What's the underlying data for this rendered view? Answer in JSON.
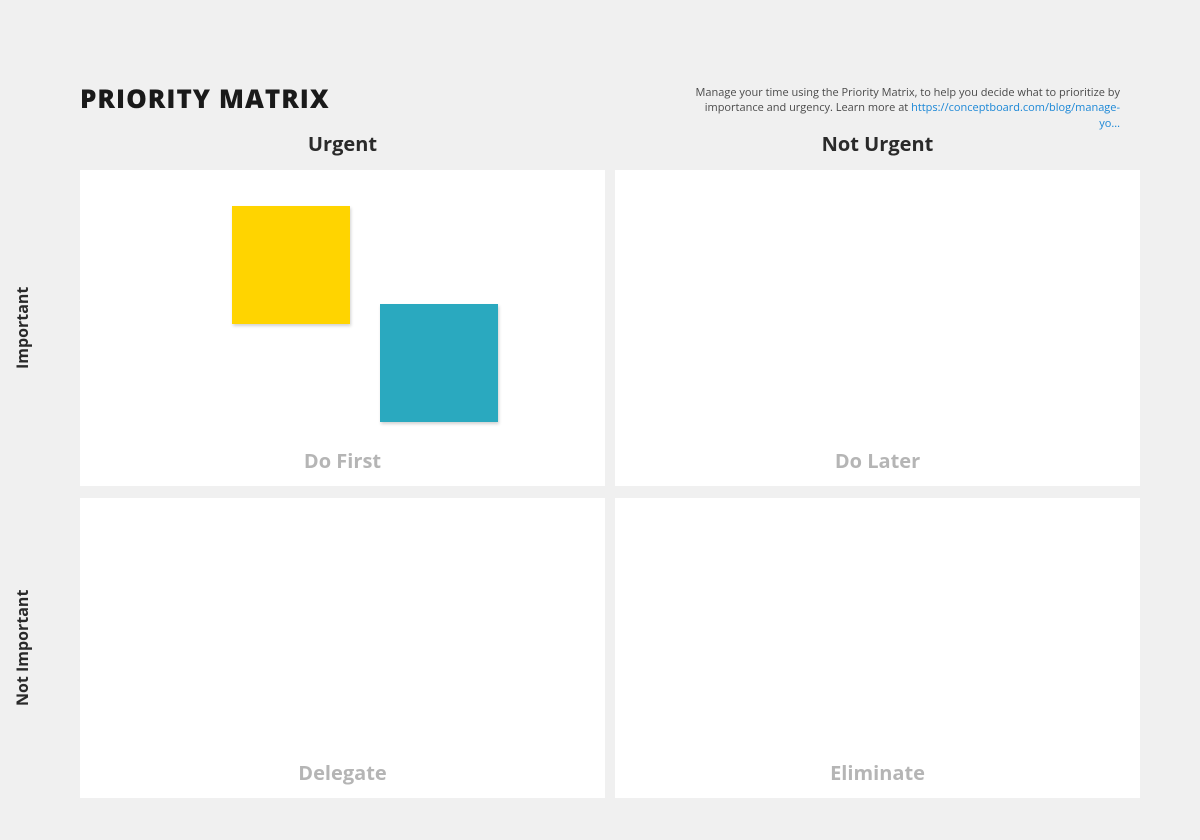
{
  "title": "PRIORITY MATRIX",
  "description": {
    "text_pre": "Manage your time using the Priority Matrix, to help you decide what to prioritize by importance and urgency. Learn more at ",
    "link_text": "https://conceptboard.com/blog/manage-yo..."
  },
  "columns": {
    "urgent": "Urgent",
    "not_urgent": "Not Urgent"
  },
  "rows": {
    "important": "Important",
    "not_important": "Not Important"
  },
  "quadrants": {
    "tl": "Do First",
    "tr": "Do Later",
    "bl": "Delegate",
    "br": "Eliminate"
  },
  "stickies": {
    "yellow_color": "#ffd400",
    "teal_color": "#2aa9bf"
  }
}
